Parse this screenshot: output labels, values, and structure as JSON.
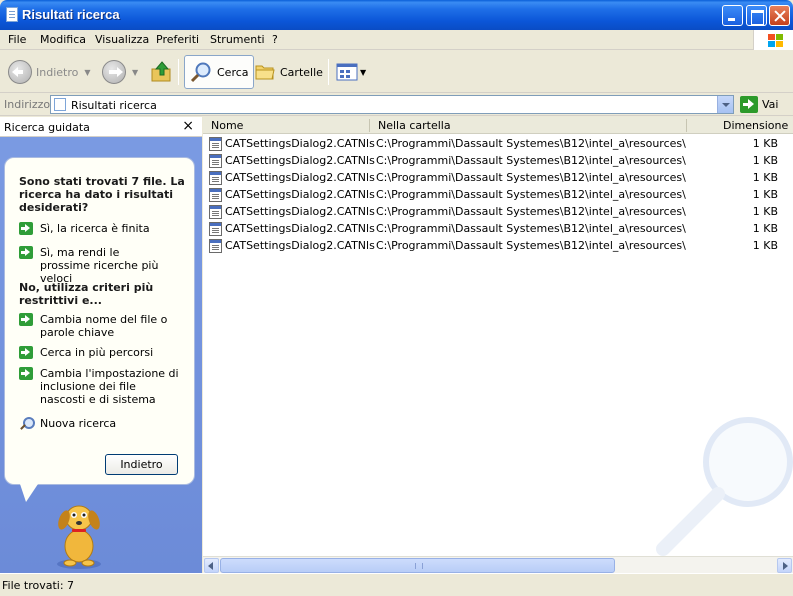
{
  "window": {
    "title": "Risultati ricerca"
  },
  "menu": [
    "File",
    "Modifica",
    "Visualizza",
    "Preferiti",
    "Strumenti",
    "?"
  ],
  "toolbar": {
    "back_label": "Indietro",
    "search_label": "Cerca",
    "folders_label": "Cartelle"
  },
  "address": {
    "label": "Indirizzo",
    "value": "Risultati ricerca",
    "go_label": "Vai"
  },
  "search_assistant": {
    "title": "Ricerca guidata",
    "close": "×",
    "heading1": "Sono stati trovati 7 file. La ricerca ha dato i risultati desiderati?",
    "opt_yes_done": "Sì, la ricerca è finita",
    "opt_yes_faster": "Sì, ma rendi le prossime ricerche più veloci",
    "heading2": "No, utilizza criteri più restrittivi e...",
    "opt_change_name": "Cambia nome del file o parole chiave",
    "opt_more_paths": "Cerca in più percorsi",
    "opt_hidden": "Cambia l'impostazione di inclusione dei file nascosti e di sistema",
    "opt_new_search": "Nuova ricerca",
    "back_button": "Indietro"
  },
  "results": {
    "columns": [
      "Nome",
      "Nella cartella",
      "Dimensione"
    ],
    "rows": [
      {
        "name": "CATSettingsDialog2.CATNls",
        "folder": "C:\\Programmi\\Dassault Systemes\\B12\\intel_a\\resources\\msg...",
        "size": "1 KB"
      },
      {
        "name": "CATSettingsDialog2.CATNls",
        "folder": "C:\\Programmi\\Dassault Systemes\\B12\\intel_a\\resources\\msg...",
        "size": "1 KB"
      },
      {
        "name": "CATSettingsDialog2.CATNls",
        "folder": "C:\\Programmi\\Dassault Systemes\\B12\\intel_a\\resources\\msg...",
        "size": "1 KB"
      },
      {
        "name": "CATSettingsDialog2.CATNls",
        "folder": "C:\\Programmi\\Dassault Systemes\\B12\\intel_a\\resources\\msg...",
        "size": "1 KB"
      },
      {
        "name": "CATSettingsDialog2.CATNls",
        "folder": "C:\\Programmi\\Dassault Systemes\\B12\\intel_a\\resources\\msg...",
        "size": "1 KB"
      },
      {
        "name": "CATSettingsDialog2.CATNls",
        "folder": "C:\\Programmi\\Dassault Systemes\\B12\\intel_a\\resources\\msg...",
        "size": "1 KB"
      },
      {
        "name": "CATSettingsDialog2.CATNls",
        "folder": "C:\\Programmi\\Dassault Systemes\\B12\\intel_a\\resources\\msg...",
        "size": "1 KB"
      }
    ]
  },
  "status": {
    "text": "File trovati: 7"
  },
  "colors": {
    "titlebar": "#0b56d8",
    "left_pane": "#6c8bd8",
    "go_green": "#2c9a2a"
  }
}
